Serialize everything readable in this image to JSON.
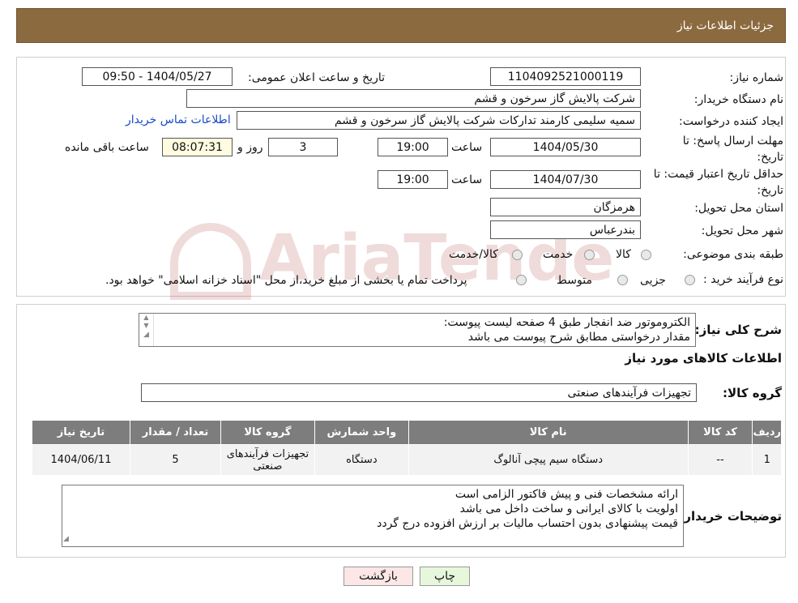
{
  "header": {
    "title": "جزئیات اطلاعات نیاز"
  },
  "form": {
    "need_number_label": "شماره نیاز:",
    "need_number": "1104092521000119",
    "announce_label": "تاریخ و ساعت اعلان عمومی:",
    "announce_value": "1404/05/27 - 09:50",
    "buyer_org_label": "نام دستگاه خریدار:",
    "buyer_org": "شرکت پالایش گاز سرخون و قشم",
    "creator_label": "ایجاد کننده درخواست:",
    "creator": "سمیه سلیمی کارمند تدارکات شرکت پالایش گاز سرخون و قشم",
    "contact_link": "اطلاعات تماس خریدار",
    "reply_deadline_label": "مهلت ارسال پاسخ: تا تاریخ:",
    "reply_date": "1404/05/30",
    "time_label": "ساعت",
    "reply_time": "19:00",
    "days": "3",
    "days_label": "روز و",
    "remaining_time": "08:07:31",
    "remaining_label": "ساعت باقی مانده",
    "price_validity_label": "حداقل تاریخ اعتبار قیمت: تا تاریخ:",
    "price_date": "1404/07/30",
    "price_time_label": "ساعت",
    "price_time": "19:00",
    "province_label": "استان محل تحویل:",
    "province": "هرمزگان",
    "city_label": "شهر محل تحویل:",
    "city": "بندرعباس",
    "category_label": "طبقه بندی موضوعی:",
    "category_options": [
      "کالا",
      "خدمت",
      "کالا/خدمت"
    ],
    "purchase_type_label": "نوع فرآیند خرید :",
    "purchase_options": [
      "جزیی",
      "متوسط"
    ],
    "purchase_note": "پرداخت تمام یا بخشی از مبلغ خرید،از محل \"اسناد خزانه اسلامی\" خواهد بود."
  },
  "watermark": {
    "text": "AriaTender.neT"
  },
  "description": {
    "label": "شرح کلی نیاز:",
    "lines": [
      "الکتروموتور ضد انفجار طبق 4 صفحه لیست پیوست:",
      "مقدار درخواستی مطابق شرح پیوست می باشد"
    ]
  },
  "goods": {
    "title": "اطلاعات کالاهای مورد نیاز",
    "group_label": "گروه کالا:",
    "group_value": "تجهیزات فرآیندهای صنعتی",
    "columns": [
      "ردیف",
      "کد کالا",
      "نام کالا",
      "واحد شمارش",
      "گروه کالا",
      "تعداد / مقدار",
      "تاریخ نیاز"
    ],
    "rows": [
      [
        "1",
        "--",
        "دستگاه سیم پیچی آنالوگ",
        "دستگاه",
        "تجهیزات فرآیندهای صنعتی",
        "5",
        "1404/06/11"
      ]
    ]
  },
  "buyer_notes": {
    "label": "توضیحات خریدار:",
    "lines": [
      "ارائه مشخصات فنی و پیش فاکتور الزامی است",
      "اولویت با کالای ایرانی و ساخت داخل می باشد",
      "قیمت پیشنهادی بدون احتساب مالیات بر ارزش افزوده درج گردد"
    ]
  },
  "buttons": {
    "print": "چاپ",
    "back": "بازگشت"
  },
  "colors": {
    "header": "#8c6a3f",
    "print_bg": "#e7f7dc",
    "back_bg": "#fde6e6"
  }
}
